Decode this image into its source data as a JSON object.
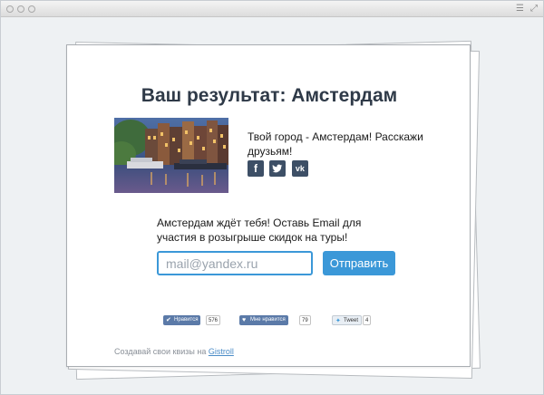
{
  "window": {
    "controls": [
      "close",
      "minimize",
      "zoom"
    ]
  },
  "quiz": {
    "title": "Ваш результат: Амстердам",
    "share_text": "Твой город - Амстердам! Расскажи друзьям!",
    "social": [
      {
        "name": "facebook",
        "glyph": "f",
        "icon": "facebook-icon"
      },
      {
        "name": "twitter",
        "glyph": "t",
        "icon": "twitter-icon"
      },
      {
        "name": "vk",
        "glyph": "vk",
        "icon": "vk-icon"
      }
    ],
    "email_prompt": "Амстердам ждёт тебя! Оставь Email для участия в розыгрыше скидок на туры!",
    "email_placeholder": "mail@yandex.ru",
    "email_value": "",
    "submit_label": "Отправить",
    "likes": [
      {
        "label": "Нравится",
        "count": "576",
        "color": "#5b7aa8"
      },
      {
        "label": "Мне нравится",
        "count": "79",
        "color": "#5b7aa8"
      },
      {
        "label": "Tweet",
        "count": "4",
        "color": "#e8eef4"
      }
    ],
    "footer_text": "Создавай свои квизы на ",
    "footer_link": "Gistroll"
  },
  "colors": {
    "accent": "#3b98d8",
    "title": "#2f3a48",
    "social": "#3d4f66",
    "link": "#4b8cc7"
  }
}
